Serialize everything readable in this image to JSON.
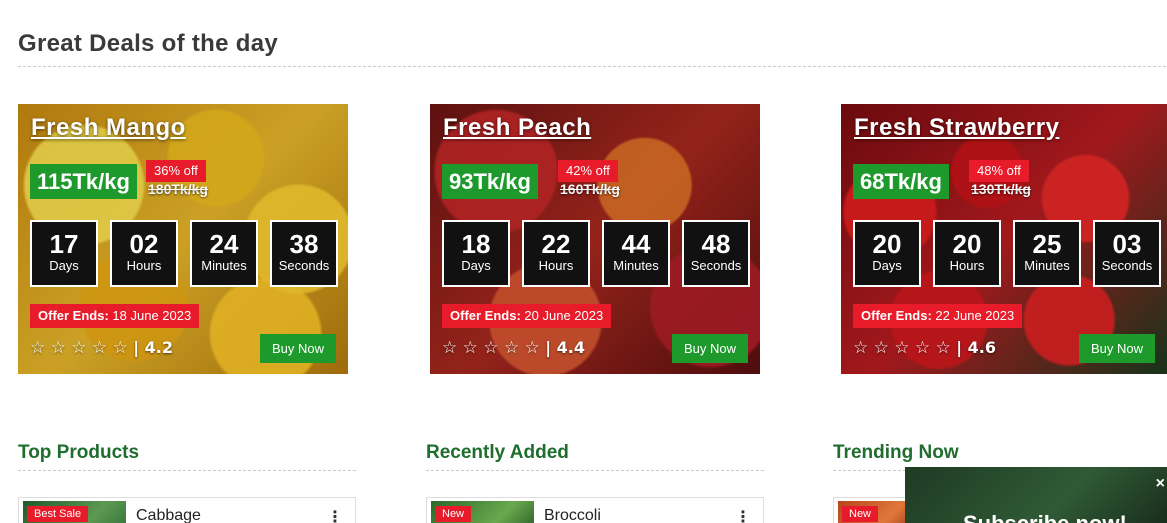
{
  "section_title": "Great Deals of the day",
  "deals": [
    {
      "name": "Fresh Mango",
      "price": "115Tk/kg",
      "discount": "36% off",
      "old_price": "180Tk/kg",
      "timer": [
        {
          "value": "17",
          "label": "Days"
        },
        {
          "value": "02",
          "label": "Hours"
        },
        {
          "value": "24",
          "label": "Minutes"
        },
        {
          "value": "38",
          "label": "Seconds"
        }
      ],
      "offer_label": "Offer Ends:",
      "offer_date": "18 June 2023",
      "stars": "☆ ☆ ☆ ☆ ☆",
      "rating": "| 4.2",
      "buy_label": "Buy Now"
    },
    {
      "name": "Fresh Peach",
      "price": "93Tk/kg",
      "discount": "42% off",
      "old_price": "160Tk/kg",
      "timer": [
        {
          "value": "18",
          "label": "Days"
        },
        {
          "value": "22",
          "label": "Hours"
        },
        {
          "value": "44",
          "label": "Minutes"
        },
        {
          "value": "48",
          "label": "Seconds"
        }
      ],
      "offer_label": "Offer Ends:",
      "offer_date": "20 June 2023",
      "stars": "☆ ☆ ☆ ☆ ☆",
      "rating": "| 4.4",
      "buy_label": "Buy Now"
    },
    {
      "name": "Fresh Strawberry",
      "price": "68Tk/kg",
      "discount": "48% off",
      "old_price": "130Tk/kg",
      "timer": [
        {
          "value": "20",
          "label": "Days"
        },
        {
          "value": "20",
          "label": "Hours"
        },
        {
          "value": "25",
          "label": "Minutes"
        },
        {
          "value": "03",
          "label": "Seconds"
        }
      ],
      "offer_label": "Offer Ends:",
      "offer_date": "22 June 2023",
      "stars": "☆ ☆ ☆ ☆ ☆",
      "rating": "| 4.6",
      "buy_label": "Buy Now"
    }
  ],
  "columns": [
    {
      "title": "Top Products",
      "product": {
        "tag": "Best Sale",
        "name": "Cabbage",
        "menu": "⋮"
      }
    },
    {
      "title": "Recently Added",
      "product": {
        "tag": "New",
        "name": "Broccoli",
        "menu": "⋮"
      }
    },
    {
      "title": "Trending Now",
      "product": {
        "tag": "New",
        "name": "",
        "menu": ""
      }
    }
  ],
  "subscribe": {
    "title": "Subscribe now!",
    "close": "×"
  },
  "colors": {
    "green": "#1e9a2c",
    "red": "#e81b2a",
    "title_green": "#1f6e2e"
  }
}
